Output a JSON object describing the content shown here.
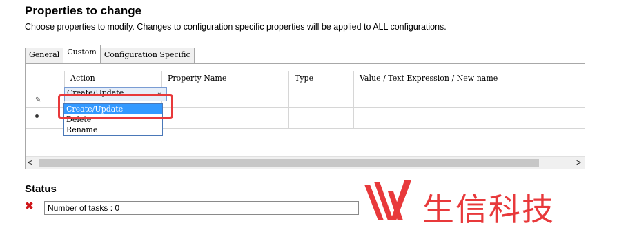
{
  "header": {
    "title": "Properties to change",
    "subtitle": "Choose properties to modify.  Changes to configuration specific properties will be applied to ALL configurations."
  },
  "tabs": [
    {
      "label": "General",
      "active": false
    },
    {
      "label": "Custom",
      "active": true
    },
    {
      "label": "Configuration Specific",
      "active": false
    }
  ],
  "grid": {
    "columns": [
      "",
      "Action",
      "Property Name",
      "Type",
      "Value / Text Expression / New name"
    ],
    "rows": [
      {
        "marker": "pencil-icon",
        "action": "Create/Update",
        "property": "",
        "type": "",
        "value": ""
      },
      {
        "marker": "new-row-icon",
        "action": "",
        "property": "",
        "type": "",
        "value": ""
      }
    ],
    "dropdown_options": [
      "Create/Update",
      "Delete",
      "Rename"
    ],
    "dropdown_selected": "Create/Update"
  },
  "scrollbar": {
    "left_arrow": "<",
    "right_arrow": ">"
  },
  "status": {
    "heading": "Status",
    "icon": "error-x-icon",
    "message": "Number of tasks : 0"
  },
  "watermark": {
    "text": "生信科技",
    "color": "#e8393b"
  }
}
